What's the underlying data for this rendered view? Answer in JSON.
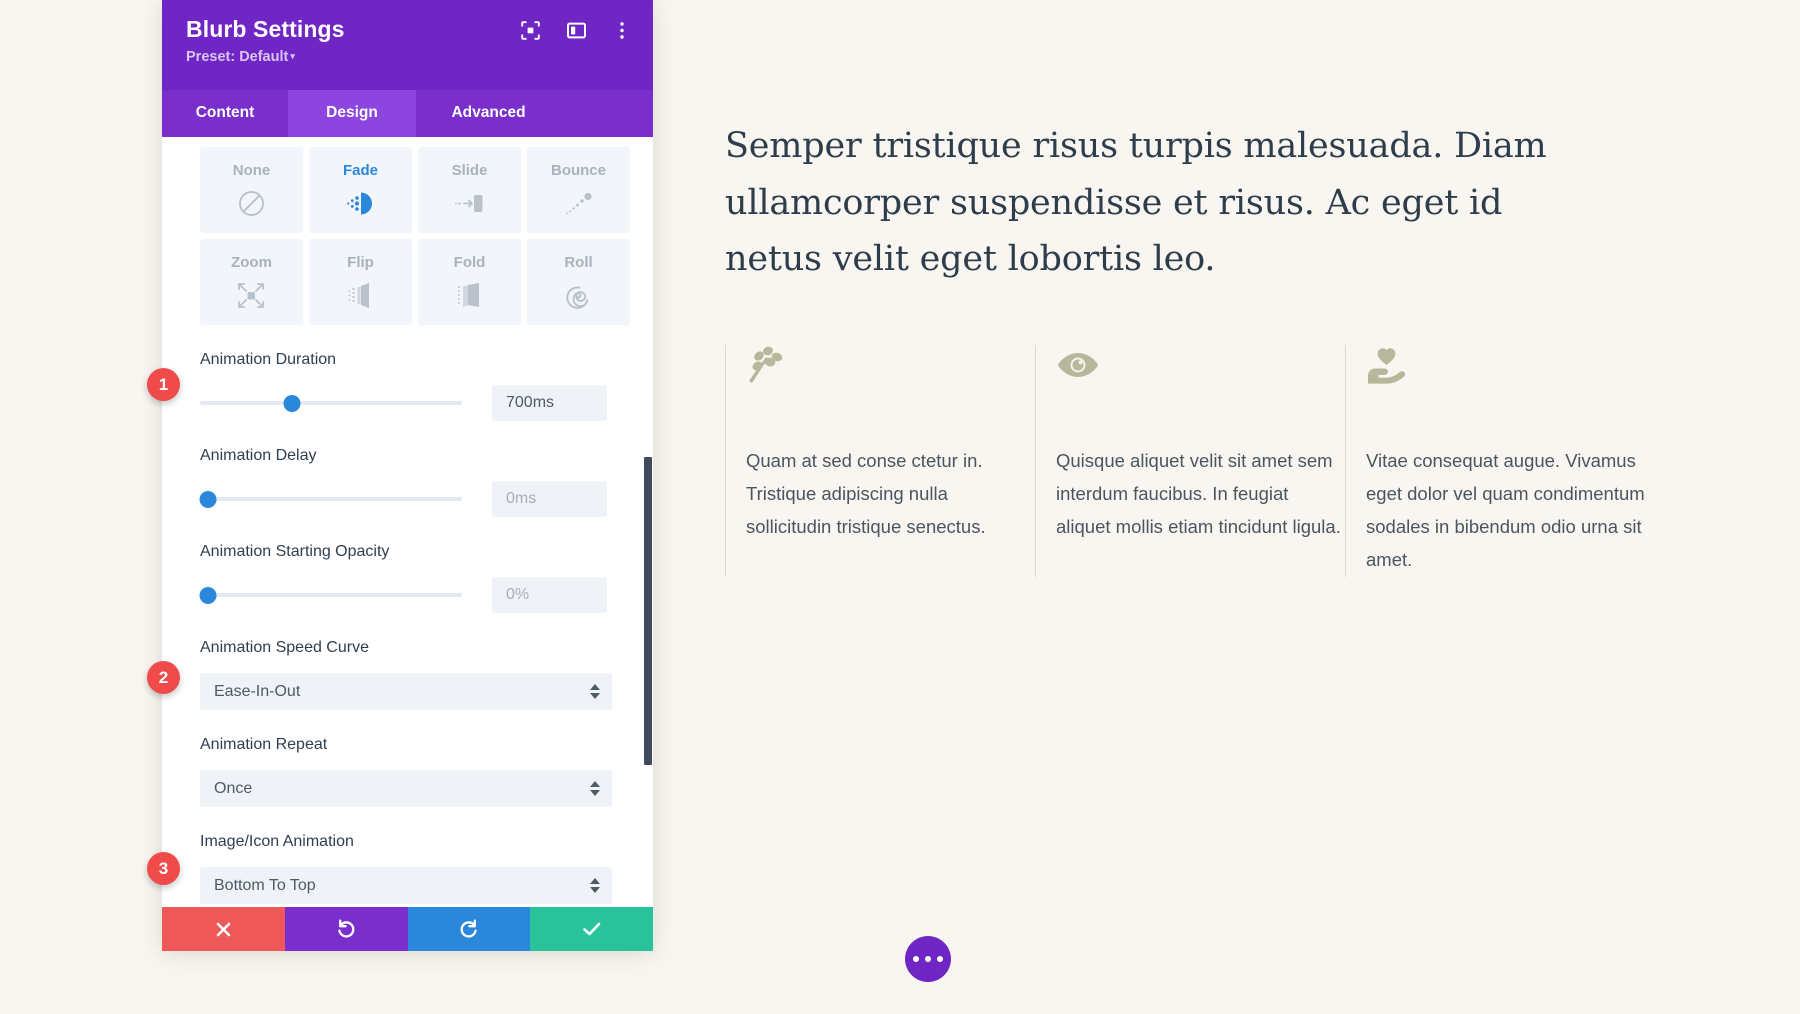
{
  "panel": {
    "title": "Blurb Settings",
    "preset_label": "Preset: Default",
    "preset_caret": "▾",
    "header_icons": [
      {
        "name": "focus-icon",
        "label": "Focus"
      },
      {
        "name": "layout-icon",
        "label": "Layout"
      },
      {
        "name": "more-vertical-icon",
        "label": "More"
      }
    ],
    "tabs": [
      {
        "label": "Content",
        "active": false
      },
      {
        "label": "Design",
        "active": true
      },
      {
        "label": "Advanced",
        "active": false
      }
    ],
    "accent_color": "#7026c4",
    "tab_active_color": "#8d45e0",
    "slider_color": "#2b87da"
  },
  "animation_presets": {
    "selected": "Fade",
    "items": [
      {
        "label": "None",
        "icon": "no-entry-icon"
      },
      {
        "label": "Fade",
        "icon": "fade-icon"
      },
      {
        "label": "Slide",
        "icon": "slide-icon"
      },
      {
        "label": "Bounce",
        "icon": "bounce-icon"
      },
      {
        "label": "Zoom",
        "icon": "zoom-icon"
      },
      {
        "label": "Flip",
        "icon": "flip-icon"
      },
      {
        "label": "Fold",
        "icon": "fold-icon"
      },
      {
        "label": "Roll",
        "icon": "roll-icon"
      }
    ]
  },
  "fields": {
    "duration": {
      "label": "Animation Duration",
      "value": "700ms",
      "slider_percent": 35
    },
    "delay": {
      "label": "Animation Delay",
      "value": "0ms",
      "slider_percent": 0
    },
    "starting_opacity": {
      "label": "Animation Starting Opacity",
      "value": "0%",
      "slider_percent": 0
    },
    "speed_curve": {
      "label": "Animation Speed Curve",
      "value": "Ease-In-Out"
    },
    "repeat": {
      "label": "Animation Repeat",
      "value": "Once"
    },
    "image_icon_animation": {
      "label": "Image/Icon Animation",
      "value": "Bottom To Top"
    }
  },
  "badges": [
    {
      "number": "1"
    },
    {
      "number": "2"
    },
    {
      "number": "3"
    }
  ],
  "footer": {
    "cancel_label": "✖",
    "undo_label": "↺",
    "redo_label": "↻",
    "save_label": "✔",
    "colors": {
      "cancel": "#ef5858",
      "undo": "#7a2fcc",
      "redo": "#2b87da",
      "save": "#28c39b"
    }
  },
  "page": {
    "background_color": "#f9f6f1",
    "heading": "Semper tristique risus turpis malesuada. Diam ullamcorper suspendisse et risus. Ac eget id netus velit eget lobortis leo.",
    "blurbs": [
      {
        "icon": "leaf-branch-icon",
        "text": "Quam at sed conse ctetur in. Tristique adipiscing nulla sollicitudin tristique senectus."
      },
      {
        "icon": "eye-icon",
        "text": "Quisque aliquet velit sit amet sem interdum faucibus. In feugiat aliquet mollis etiam tincidunt ligula."
      },
      {
        "icon": "heart-hand-icon",
        "text": "Vitae consequat augue. Vivamus eget dolor vel quam condimentum sodales in bibendum odio urna sit amet."
      }
    ],
    "fab": {
      "name": "page-settings-fab",
      "dots": 3
    }
  }
}
